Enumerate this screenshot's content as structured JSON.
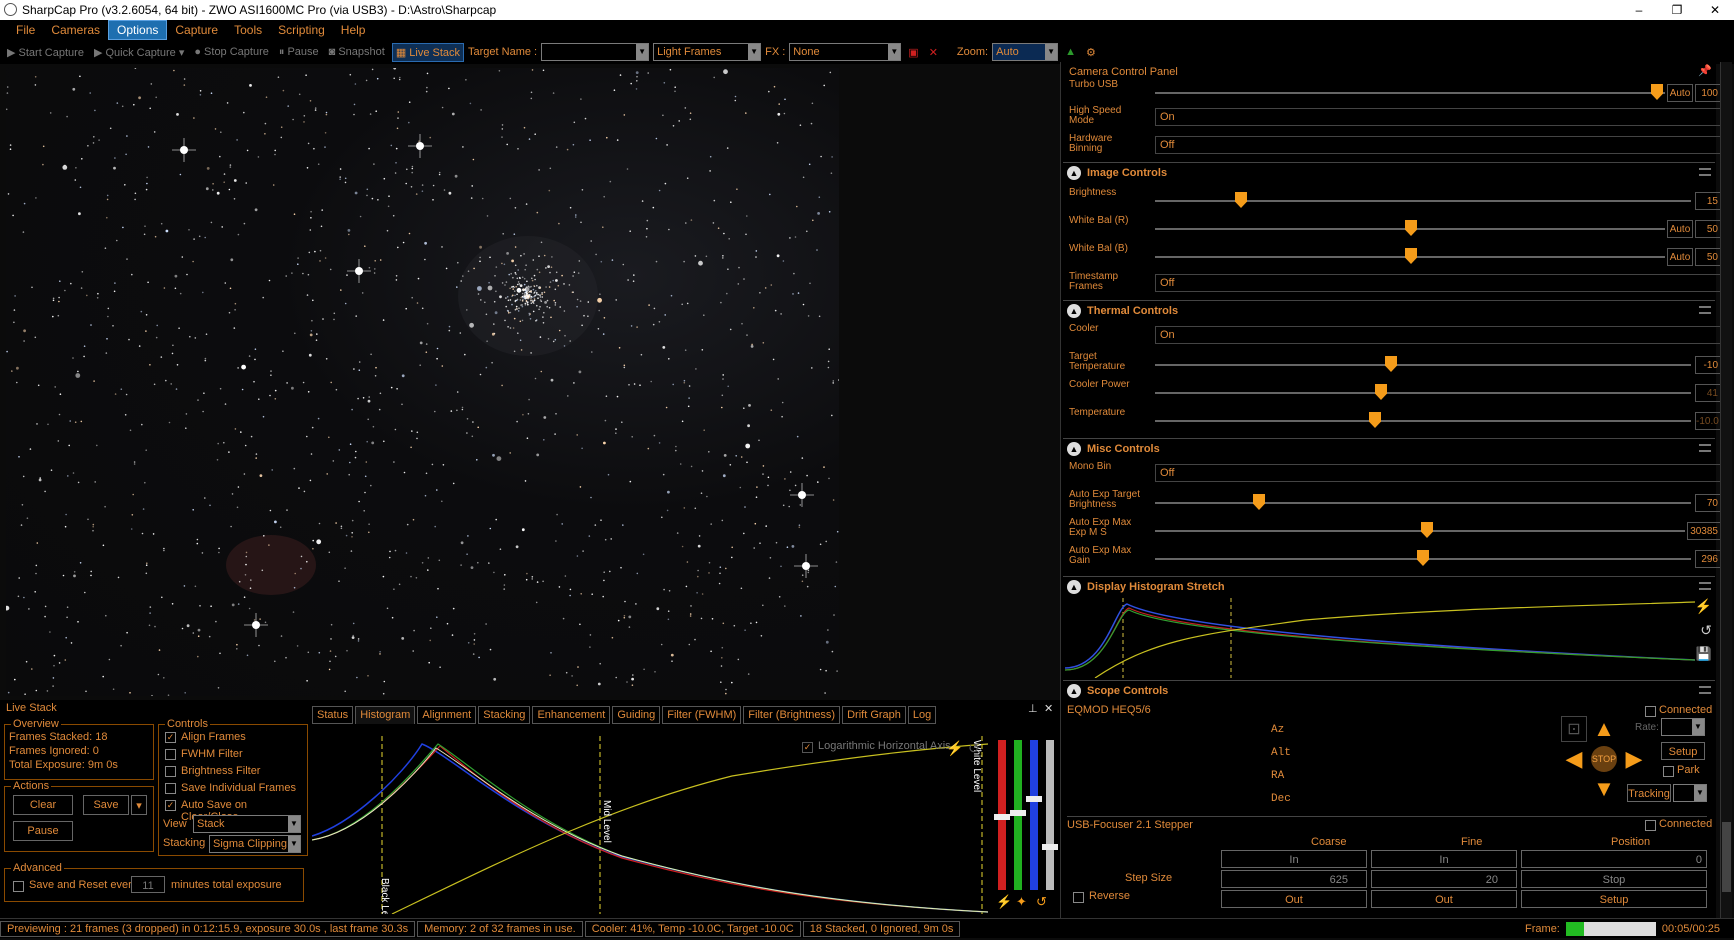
{
  "window": {
    "title": "SharpCap Pro (v3.2.6054, 64 bit) - ZWO ASI1600MC Pro (via USB3) - D:\\Astro\\Sharpcap",
    "min": "–",
    "max": "❐",
    "close": "✕"
  },
  "menu": [
    "File",
    "Cameras",
    "Options",
    "Capture",
    "Tools",
    "Scripting",
    "Help"
  ],
  "toolbar": {
    "start_capture": "Start Capture",
    "quick_capture": "Quick Capture",
    "stop_capture": "Stop Capture",
    "pause": "Pause",
    "snapshot": "Snapshot",
    "live_stack": "Live Stack",
    "target_label": "Target Name :",
    "target_value": "",
    "frame_type": "Light Frames",
    "fx_label": "FX :",
    "fx_value": "None",
    "zoom_label": "Zoom:",
    "zoom_value": "Auto"
  },
  "panel": {
    "title": "Camera Control Panel",
    "turbo": {
      "label": "Turbo USB",
      "auto": "Auto",
      "value": "100",
      "pos": 0.96
    },
    "high_speed": {
      "label": "High Speed Mode",
      "value": "On"
    },
    "hw_binning": {
      "label": "Hardware Binning",
      "value": "Off"
    },
    "image_controls": "Image Controls",
    "brightness": {
      "label": "Brightness",
      "value": "15",
      "pos": 0.15
    },
    "wb_r": {
      "label": "White Bal (R)",
      "auto": "Auto",
      "value": "50",
      "pos": 0.5
    },
    "wb_b": {
      "label": "White Bal (B)",
      "auto": "Auto",
      "value": "50",
      "pos": 0.5
    },
    "timestamp": {
      "label": "Timestamp Frames",
      "value": "Off"
    },
    "thermal": "Thermal Controls",
    "cooler": {
      "label": "Cooler",
      "value": "On"
    },
    "target_temp": {
      "label": "Target Temperature",
      "value": "-10",
      "pos": 0.43
    },
    "cooler_power": {
      "label": "Cooler Power",
      "value": "41",
      "pos": 0.41
    },
    "temperature": {
      "label": "Temperature",
      "value": "-10.0",
      "pos": 0.4
    },
    "misc": "Misc Controls",
    "mono_bin": {
      "label": "Mono Bin",
      "value": "Off"
    },
    "ae_target": {
      "label": "Auto Exp Target Brightness",
      "value": "70",
      "pos": 0.18
    },
    "ae_max_exp": {
      "label": "Auto Exp Max Exp M S",
      "value": "30385",
      "pos": 0.51
    },
    "ae_max_gain": {
      "label": "Auto Exp Max Gain",
      "value": "296",
      "pos": 0.49
    },
    "hist": "Display Histogram Stretch",
    "scope": "Scope Controls",
    "mount": "EQMOD HEQ5/6",
    "connected": "Connected",
    "az": "Az",
    "alt": "Alt",
    "ra": "RA",
    "dec": "Dec",
    "rate": "Rate:",
    "setup": "Setup",
    "park": "Park",
    "tracking": "Tracking",
    "stop": "STOP",
    "focuser": "USB-Focuser 2.1 Stepper",
    "coarse": "Coarse",
    "fine": "Fine",
    "position": "Position",
    "in": "In",
    "pos_value": "0",
    "step_size": "Step Size",
    "coarse_step": "625",
    "fine_step": "20",
    "stop_btn": "Stop",
    "reverse": "Reverse",
    "out": "Out",
    "setup_btn": "Setup"
  },
  "livestack": {
    "title": "Live Stack",
    "overview": "Overview",
    "frames_stacked": "Frames Stacked:  18",
    "frames_ignored": "Frames Ignored:  0",
    "total_exposure": "Total Exposure:  9m 0s",
    "actions": "Actions",
    "clear": "Clear",
    "save": "Save",
    "pause": "Pause",
    "advanced": "Advanced",
    "save_reset": "Save and Reset every",
    "reset_minutes": "11",
    "minutes_total": "minutes total exposure",
    "controls": "Controls",
    "align": "Align Frames",
    "fwhm": "FWHM Filter",
    "brightness_filter": "Brightness Filter",
    "save_individual": "Save Individual Frames",
    "auto_save": "Auto Save on Clear/Close",
    "view_label": "View",
    "view_value": "Stack",
    "stacking_label": "Stacking",
    "stacking_value": "Sigma Clipping",
    "tabs": [
      "Status",
      "Histogram",
      "Alignment",
      "Stacking",
      "Enhancement",
      "Guiding",
      "Filter (FWHM)",
      "Filter (Brightness)",
      "Drift Graph",
      "Log"
    ],
    "log_axis": "Logarithmic Horizontal Axis",
    "black": "Black Level",
    "mid": "Mid Level",
    "white": "White Level"
  },
  "status": {
    "preview": "Previewing : 21 frames (3 dropped) in 0:12:15.9, exposure 30.0s , last frame 30.3s",
    "memory": "Memory: 2 of 32 frames in use.",
    "cooler": "Cooler: 41%, Temp -10.0C, Target -10.0C",
    "stacked": "18 Stacked, 0 Ignored, 9m 0s",
    "frame_label": "Frame:",
    "frame_time": "00:05/00:25",
    "frame_progress": 0.2
  }
}
